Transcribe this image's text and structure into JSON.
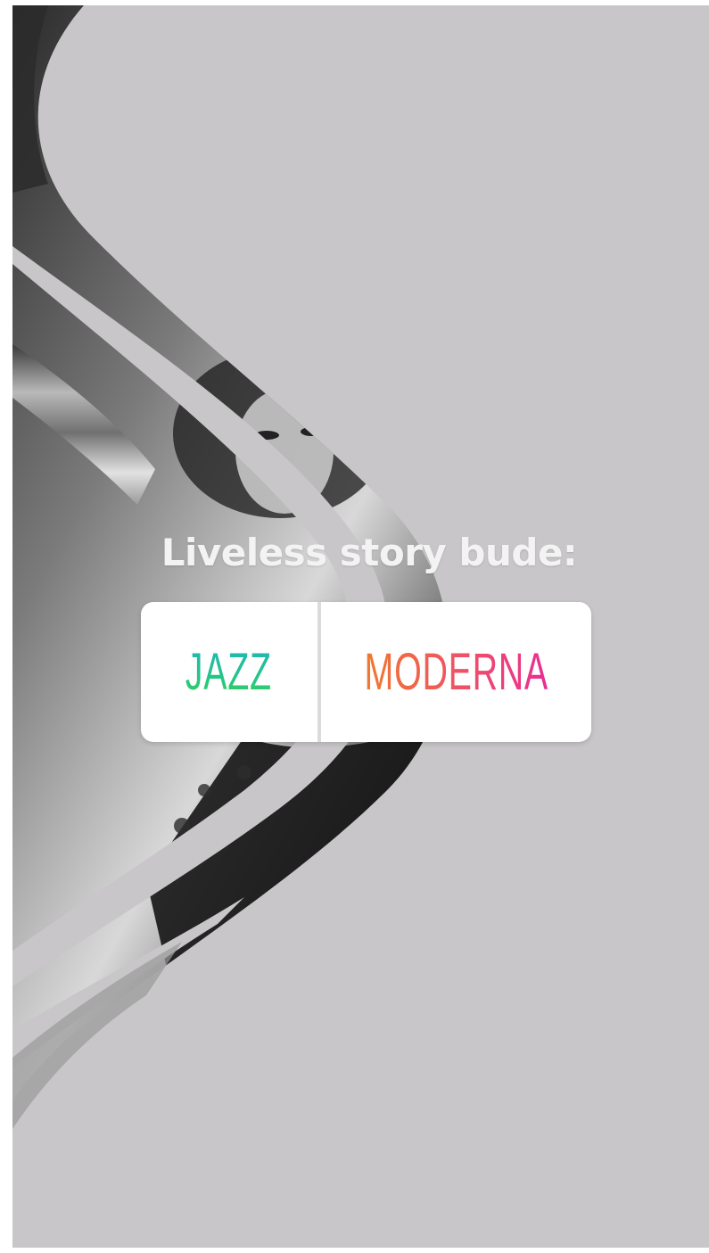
{
  "story": {
    "question": "Liveless story bude:",
    "background_color": "#c8c6c8",
    "photo_style": "grayscale"
  },
  "poll": {
    "options": [
      {
        "label": "JAZZ",
        "gradient": [
          "#1fb7b7",
          "#33cf5d"
        ]
      },
      {
        "label": "MODERNA",
        "gradient": [
          "#f1782d",
          "#ea2d93"
        ]
      }
    ]
  }
}
